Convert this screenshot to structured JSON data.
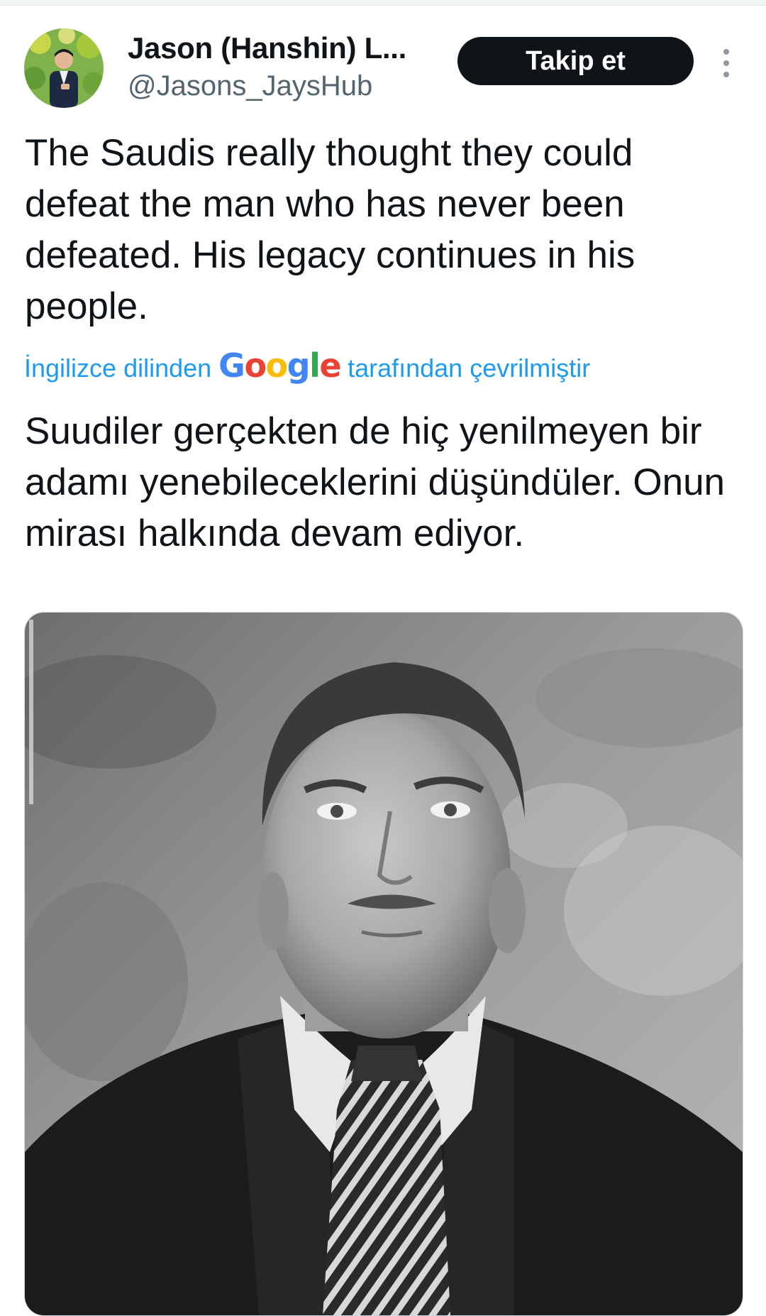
{
  "author": {
    "display_name": "Jason (Hanshin) L...",
    "handle": "@Jasons_JaysHub",
    "avatar_icon": "user-avatar-photo"
  },
  "actions": {
    "follow_label": "Takip et",
    "more_icon": "more-vertical-icon"
  },
  "tweet": {
    "text": "The Saudis really thought they could defeat the man who has never been defeated. His legacy continues in his people.",
    "translation_prefix": "İngilizce dilinden",
    "translation_provider": "Google",
    "translation_suffix": "tarafından çevrilmiştir",
    "translated_text": "Suudiler gerçekten de hiç yenilmeyen bir adamı yenebileceklerini düşündüler. Onun mirası halkında devam ediyor."
  },
  "media": {
    "kind": "black-and-white portrait photo"
  },
  "colors": {
    "text_primary": "#0f1419",
    "text_secondary": "#536471",
    "link": "#1d9bf0",
    "button_bg": "#0f1419",
    "button_text": "#ffffff"
  }
}
